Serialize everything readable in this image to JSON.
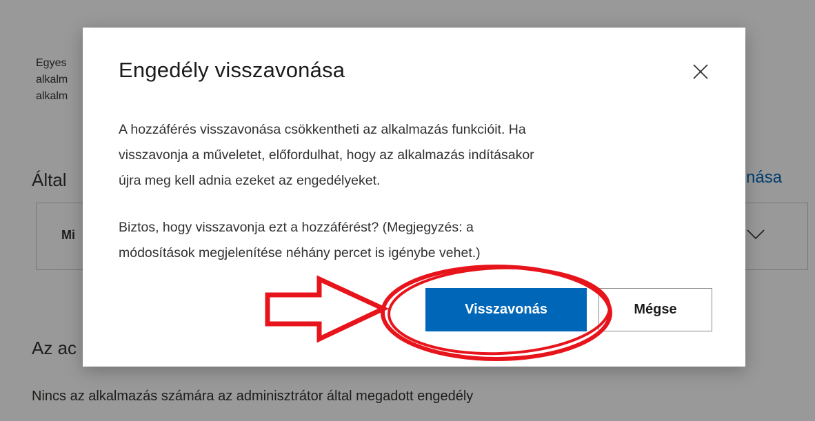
{
  "background": {
    "paragraph_lines": [
      "Egyes",
      "alkalm",
      "alkalm"
    ],
    "heading1": "Által",
    "card_label": "Mi",
    "link_text": "nása",
    "heading2": "Az ac",
    "footer_text": "Nincs az alkalmazás számára az adminisztrátor által megadott engedély"
  },
  "dialog": {
    "title": "Engedély visszavonása",
    "close_icon": "close-icon",
    "paragraph1_lines": [
      "A hozzáférés visszavonása csökkentheti az alkalmazás funkcióit. Ha",
      "visszavonja a műveletet, előfordulhat, hogy az alkalmazás indításakor",
      "újra meg kell adnia ezeket az engedélyeket."
    ],
    "paragraph2_lines": [
      "Biztos, hogy visszavonja ezt a hozzáférést? (Megjegyzés: a",
      "módosítások megjelenítése néhány percet is igénybe vehet.)"
    ],
    "primary_button": "Visszavonás",
    "secondary_button": "Mégse"
  },
  "colors": {
    "accent": "#0067b8",
    "annotation": "#e8141c",
    "overlay": "rgba(0,0,0,0.4)"
  },
  "annotation": {
    "arrow_icon": "arrow-right-icon",
    "ellipse_icon": "highlight-ellipse-icon"
  }
}
